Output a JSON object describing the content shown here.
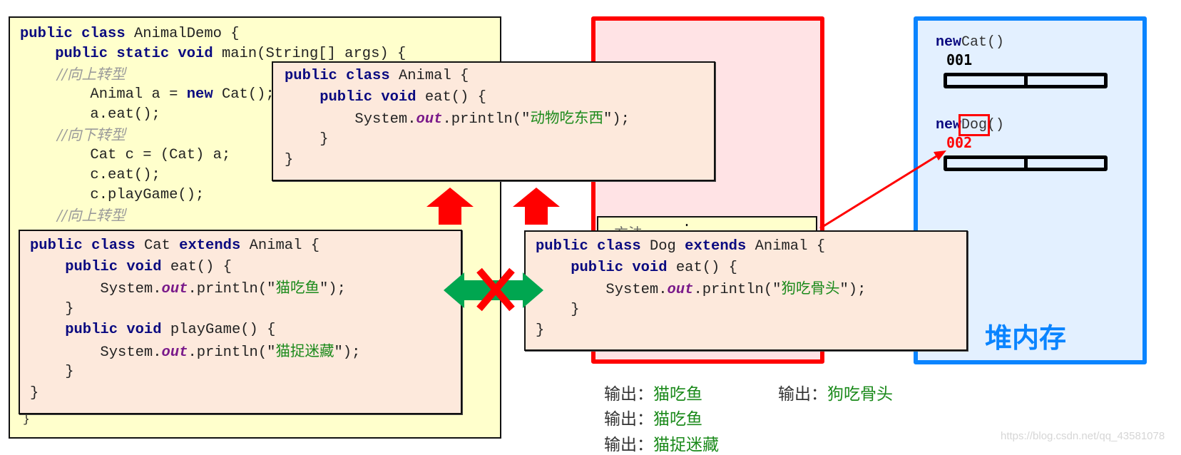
{
  "main_demo": {
    "lines": [
      {
        "parts": [
          {
            "t": "public class ",
            "c": "kw"
          },
          {
            "t": "AnimalDemo {",
            "c": ""
          }
        ]
      },
      {
        "parts": [
          {
            "t": "    public static void ",
            "c": "kw"
          },
          {
            "t": "main(String[] args) {",
            "c": ""
          }
        ]
      },
      {
        "parts": [
          {
            "t": "        //向上转型",
            "c": "cmt"
          }
        ]
      },
      {
        "parts": [
          {
            "t": "        Animal a = ",
            "c": ""
          },
          {
            "t": "new",
            "c": "kw"
          },
          {
            "t": " Cat();",
            "c": ""
          }
        ]
      },
      {
        "parts": [
          {
            "t": "        a.eat();",
            "c": ""
          }
        ]
      },
      {
        "parts": [
          {
            "t": "        //向下转型",
            "c": "cmt"
          }
        ]
      },
      {
        "parts": [
          {
            "t": "        Cat c = (Cat) a;",
            "c": ""
          }
        ]
      },
      {
        "parts": [
          {
            "t": "        c.eat();",
            "c": ""
          }
        ]
      },
      {
        "parts": [
          {
            "t": "        c.playGame();",
            "c": ""
          }
        ]
      },
      {
        "parts": [
          {
            "t": "        //向上转型",
            "c": "cmt"
          }
        ]
      }
    ],
    "closing_brace": "}"
  },
  "animal_class": {
    "lines": [
      {
        "parts": [
          {
            "t": "public class ",
            "c": "kw"
          },
          {
            "t": "Animal {",
            "c": ""
          }
        ]
      },
      {
        "parts": [
          {
            "t": "    public void ",
            "c": "kw"
          },
          {
            "t": "eat() {",
            "c": ""
          }
        ]
      },
      {
        "parts": [
          {
            "t": "        System.",
            "c": ""
          },
          {
            "t": "out",
            "c": "out"
          },
          {
            "t": ".println(\"",
            "c": ""
          },
          {
            "t": "动物吃东西",
            "c": "str"
          },
          {
            "t": "\");",
            "c": ""
          }
        ]
      },
      {
        "parts": [
          {
            "t": "    }",
            "c": ""
          }
        ]
      },
      {
        "parts": [
          {
            "t": "}",
            "c": ""
          }
        ]
      }
    ]
  },
  "cat_class": {
    "lines": [
      {
        "parts": [
          {
            "t": "public class ",
            "c": "kw"
          },
          {
            "t": "Cat ",
            "c": ""
          },
          {
            "t": "extends ",
            "c": "kw"
          },
          {
            "t": "Animal {",
            "c": ""
          }
        ]
      },
      {
        "parts": [
          {
            "t": "    public void ",
            "c": "kw"
          },
          {
            "t": "eat() {",
            "c": ""
          }
        ]
      },
      {
        "parts": [
          {
            "t": "        System.",
            "c": ""
          },
          {
            "t": "out",
            "c": "out"
          },
          {
            "t": ".println(\"",
            "c": ""
          },
          {
            "t": "猫吃鱼",
            "c": "str"
          },
          {
            "t": "\");",
            "c": ""
          }
        ]
      },
      {
        "parts": [
          {
            "t": "    }",
            "c": ""
          }
        ]
      },
      {
        "parts": [
          {
            "t": "    public void ",
            "c": "kw"
          },
          {
            "t": "playGame() {",
            "c": ""
          }
        ]
      },
      {
        "parts": [
          {
            "t": "        System.",
            "c": ""
          },
          {
            "t": "out",
            "c": "out"
          },
          {
            "t": ".println(\"",
            "c": ""
          },
          {
            "t": "猫捉迷藏",
            "c": "str"
          },
          {
            "t": "\");",
            "c": ""
          }
        ]
      },
      {
        "parts": [
          {
            "t": "    }",
            "c": ""
          }
        ]
      },
      {
        "parts": [
          {
            "t": "}",
            "c": ""
          }
        ]
      }
    ]
  },
  "dog_class": {
    "lines": [
      {
        "parts": [
          {
            "t": "public class ",
            "c": "kw"
          },
          {
            "t": "Dog ",
            "c": ""
          },
          {
            "t": "extends ",
            "c": "kw"
          },
          {
            "t": "Animal {",
            "c": ""
          }
        ]
      },
      {
        "parts": [
          {
            "t": "    public void ",
            "c": "kw"
          },
          {
            "t": "eat() {",
            "c": ""
          }
        ]
      },
      {
        "parts": [
          {
            "t": "        System.",
            "c": ""
          },
          {
            "t": "out",
            "c": "out"
          },
          {
            "t": ".println(\"",
            "c": ""
          },
          {
            "t": "狗吃骨头",
            "c": "str"
          },
          {
            "t": "\");",
            "c": ""
          }
        ]
      },
      {
        "parts": [
          {
            "t": "    }",
            "c": ""
          }
        ]
      },
      {
        "parts": [
          {
            "t": "}",
            "c": ""
          }
        ]
      }
    ]
  },
  "stack_area": {
    "method_box_text": "方法",
    "method_box_dot": "·"
  },
  "heap": {
    "label": "堆内存",
    "objects": [
      {
        "keyword": "new",
        "class_name": "Cat",
        "parens": "()",
        "address": "001",
        "address_color": "#000000",
        "highlighted": false
      },
      {
        "keyword": "new",
        "class_name": "Dog",
        "parens": "()",
        "address": "002",
        "address_color": "#ff0000",
        "highlighted": true
      }
    ]
  },
  "outputs": [
    {
      "label": "输出：",
      "value": "猫吃鱼"
    },
    {
      "label": "输出：",
      "value": "猫吃鱼"
    },
    {
      "label": "输出：",
      "value": "猫捉迷藏"
    },
    {
      "label": "输出：",
      "value": "狗吃骨头"
    }
  ],
  "colors": {
    "code_keyword": "#0a0a80",
    "string_literal": "#1b8a1b",
    "stack_border": "#ff0000",
    "heap_border": "#0a84ff",
    "arrow_up": "#ff0000",
    "double_arrow": "#00a650",
    "forbidden_x": "#ff0000"
  },
  "watermark": "https://blog.csdn.net/qq_43581078"
}
